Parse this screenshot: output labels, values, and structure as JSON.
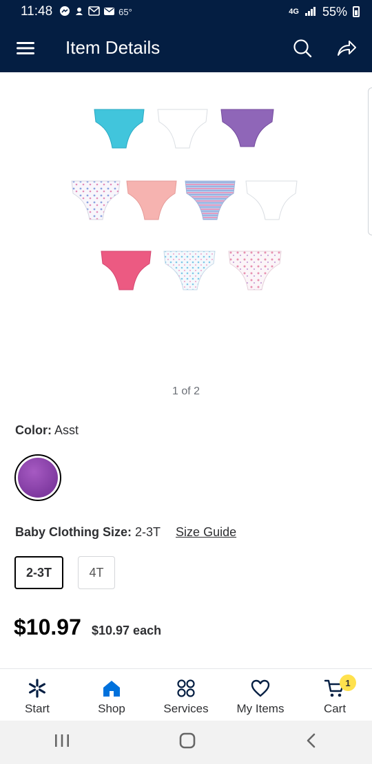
{
  "status_bar": {
    "time": "11:48",
    "weather": "65°",
    "network": "4G",
    "battery": "55%"
  },
  "header": {
    "title": "Item Details"
  },
  "product": {
    "image_pager": "1 of 2",
    "color_label": "Color:",
    "color_value": "Asst",
    "size_label": "Baby Clothing Size:",
    "size_value": "2-3T",
    "size_guide": "Size Guide",
    "sizes": [
      "2-3T",
      "4T"
    ],
    "selected_size": "2-3T",
    "price": "$10.97",
    "unit_price": "$10.97 each",
    "swatch_color": "#8e45b0"
  },
  "bottom_nav": {
    "items": [
      {
        "label": "Start",
        "icon": "spark-icon"
      },
      {
        "label": "Shop",
        "icon": "home-icon"
      },
      {
        "label": "Services",
        "icon": "services-grid-icon"
      },
      {
        "label": "My Items",
        "icon": "heart-icon"
      },
      {
        "label": "Cart",
        "icon": "cart-icon"
      }
    ],
    "cart_count": "1",
    "active": "Shop"
  },
  "colors": {
    "brand_dark": "#041e42",
    "active_blue": "#0071dc",
    "badge_yellow": "#ffe14d"
  }
}
